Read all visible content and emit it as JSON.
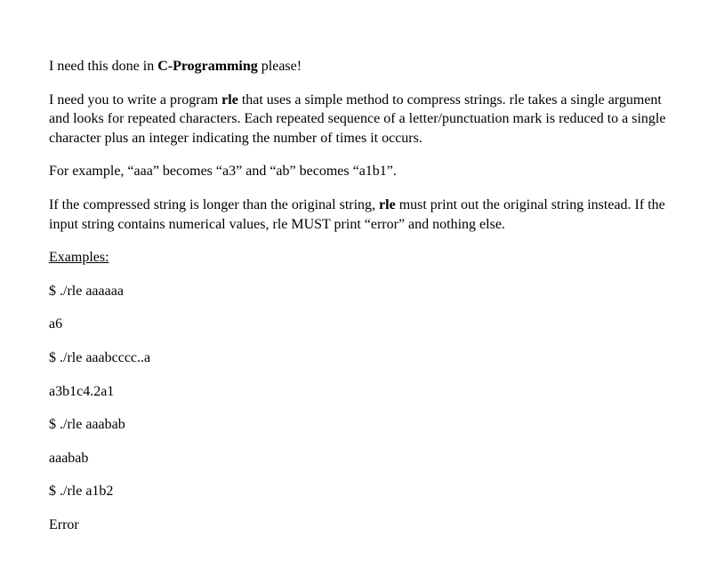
{
  "p1": {
    "pre": "I need this done in ",
    "bold": "C-Programming",
    "post": " please!"
  },
  "p2": {
    "pre": "I need you to write a program ",
    "bold": "rle",
    "post": " that uses a simple method to compress strings. rle takes a single argument and looks for repeated characters. Each repeated sequence of a letter/punctuation mark is reduced to a single character plus an integer indicating the number of times it occurs."
  },
  "p3": "For example, “aaa” becomes “a3” and “ab” becomes “a1b1”.",
  "p4": {
    "pre": "If the compressed string is longer than the original string, ",
    "bold": "rle",
    "post": " must print out the original string instead. If the input string contains numerical values, rle MUST print “error” and nothing else."
  },
  "examplesHeading": "Examples:",
  "ex1cmd": "$  ./rle aaaaaa",
  "ex1out": "a6",
  "ex2cmd": "$  ./rle aaabcccc..a",
  "ex2out": "a3b1c4.2a1",
  "ex3cmd": "$  ./rle aaabab",
  "ex3out": "aaabab",
  "ex4cmd": "$  ./rle a1b2",
  "ex4out": "Error"
}
